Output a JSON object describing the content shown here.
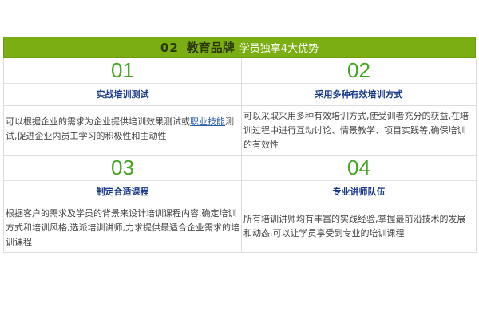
{
  "banner": {
    "number": "02",
    "title": "教育品牌",
    "subtitle": "学员独享4大优势"
  },
  "advantages": [
    {
      "number": "01",
      "label": "实战培训测试",
      "text_before": "可以根据企业的需求为企业提供培训效果测试或",
      "link": "职业技能",
      "text_after": "测试,促进企业内员工学习的积极性和主动性"
    },
    {
      "number": "02",
      "label": "采用多种有效培训方式",
      "text": "可以采取采用多种有效培训方式,使受训者充分的获益,在培训过程中进行互动讨论、情景教学、项目实践等,确保培训的有效性"
    },
    {
      "number": "03",
      "label": "制定合适课程",
      "text": "根据客户的需求及学员的背景来设计培训课程内容,确定培训方式和培训风格,选派培训讲师,力求提供最适合企业需求的培训课程"
    },
    {
      "number": "04",
      "label": "专业讲师队伍",
      "text": "所有培训讲师均有丰富的实践经验,掌握最前沿技术的发展和动态,可以让学员享受到专业的培训课程"
    }
  ],
  "colors": {
    "banner_bg": "#7bae12",
    "number_green": "#45a524",
    "label_blue": "#1a3a8c",
    "link_blue": "#2a5db0"
  }
}
